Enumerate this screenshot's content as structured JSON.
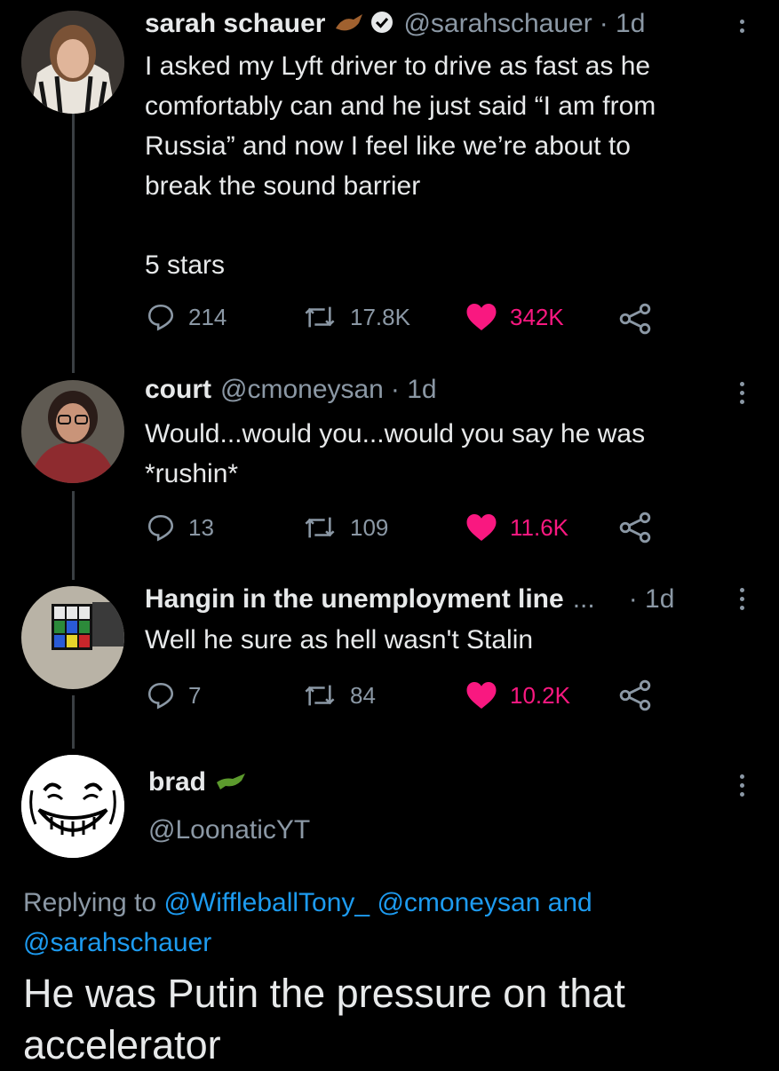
{
  "tweets": [
    {
      "name": "sarah schauer",
      "handle": "@sarahschauer",
      "time": "· 1d",
      "text": "I asked my Lyft driver to drive as fast as he\ncomfortably can and he just said “I am from\nRussia” and now I feel like we’re about to\nbreak the sound barrier",
      "text2": "5 stars",
      "replies": "214",
      "retweets": "17.8K",
      "likes": "342K",
      "verified": true
    },
    {
      "name": "court",
      "handle": "@cmoneysan",
      "time": "· 1d",
      "text": "Would...would you...would you say he was\n*rushin*",
      "replies": "13",
      "retweets": "109",
      "likes": "11.6K"
    },
    {
      "name": "Hangin in the unemployment line",
      "ellipsis": "...",
      "time": "· 1d",
      "text": "Well he sure as hell wasn't Stalin",
      "replies": "7",
      "retweets": "84",
      "likes": "10.2K"
    }
  ],
  "main_tweet": {
    "name": "brad",
    "handle": "@LoonaticYT",
    "replying_prefix": "Replying to",
    "replying_users": [
      "@WiffleballTony_",
      "@cmoneysan",
      "@sarahschauer"
    ],
    "replying_and": "and",
    "text": "He was Putin the pressure on that\naccelerator"
  },
  "colors": {
    "like": "#f91880",
    "link": "#1d9bf0",
    "muted": "#8b98a5",
    "text": "#e7e9ea"
  },
  "icons": [
    "reply-icon",
    "retweet-icon",
    "heart-icon",
    "share-icon",
    "more-icon",
    "verified-icon",
    "crocodile-icon"
  ]
}
